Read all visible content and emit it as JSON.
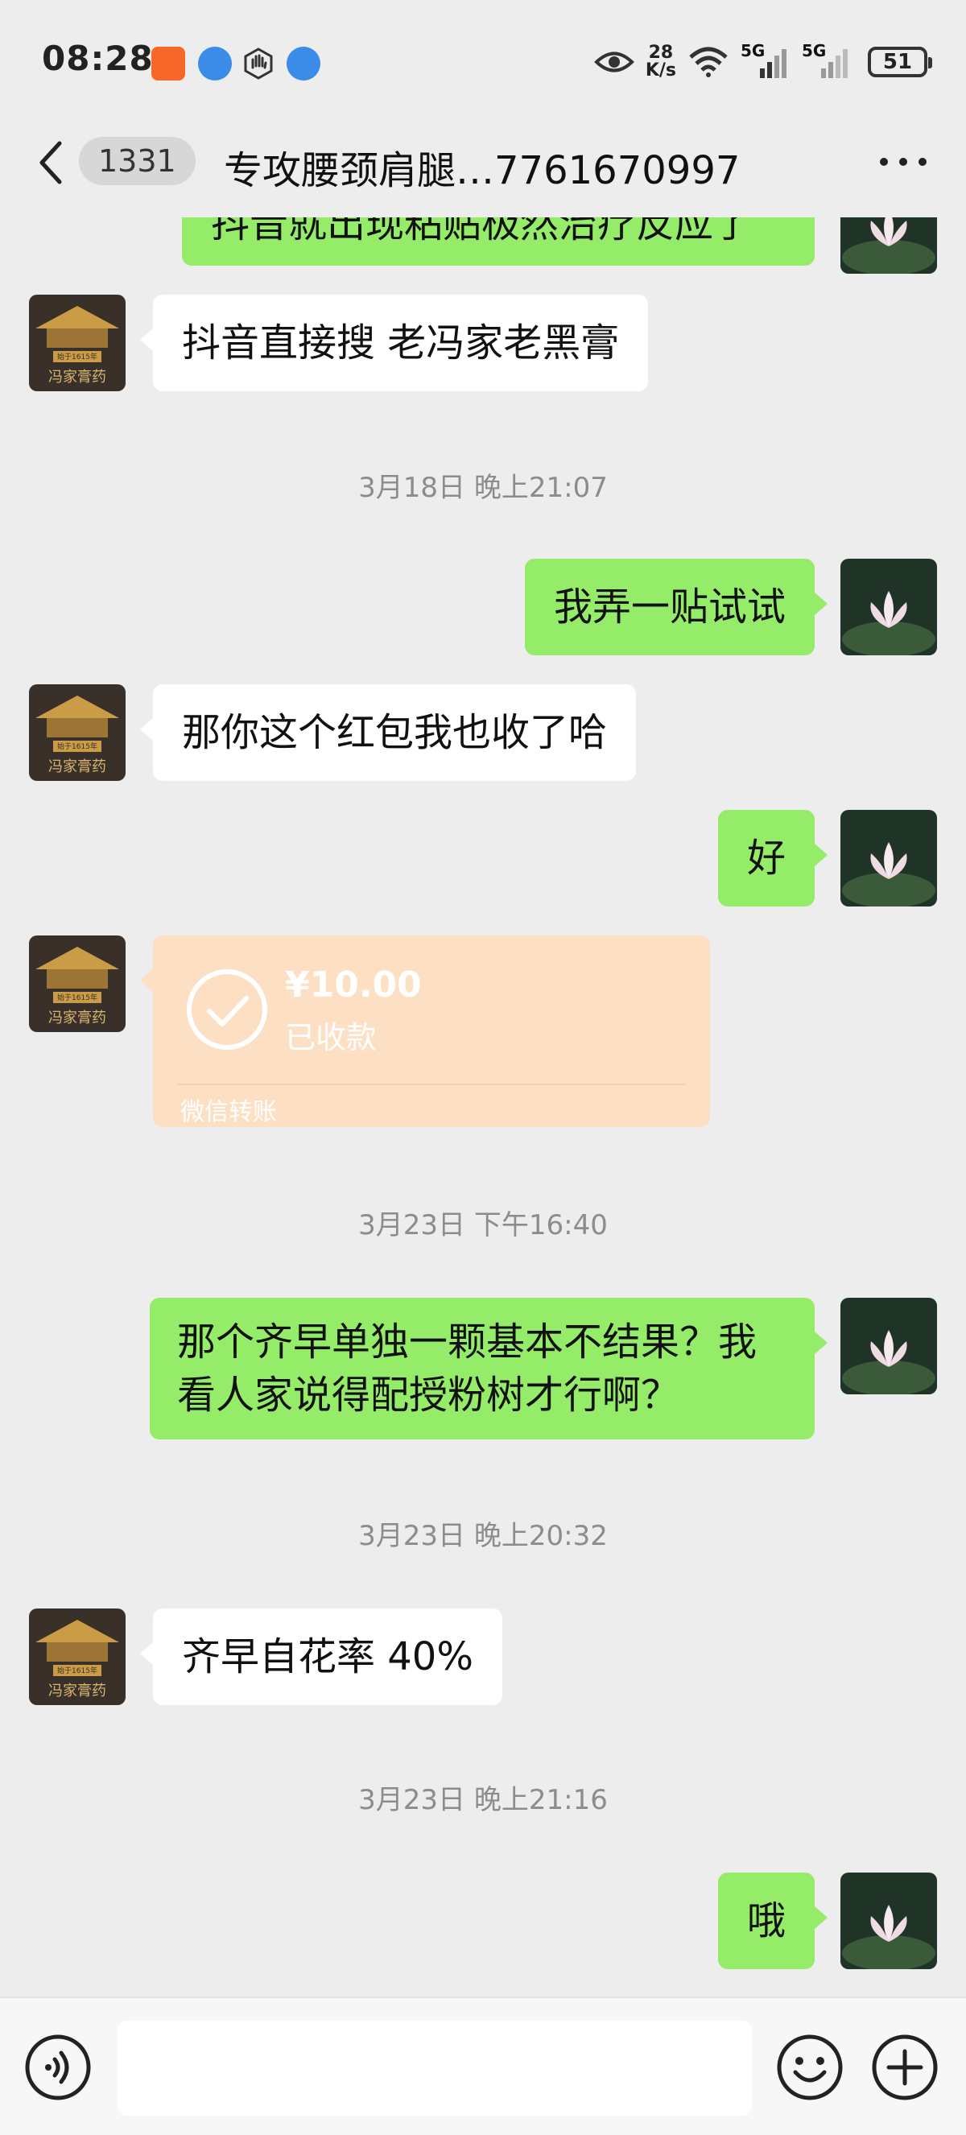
{
  "status_bar": {
    "time": "08:28",
    "net_speed_value": "28",
    "net_speed_unit": "K/s",
    "signal_label_1": "5G",
    "signal_label_2": "5G",
    "battery": "51"
  },
  "header": {
    "unread_count": "1331",
    "title": "专攻腰颈肩腿…7761670997"
  },
  "messages": {
    "m0_partial": "抖音就出现粘贴极然治疗反应了",
    "m1": "抖音直接搜  老冯家老黑膏",
    "ts1": "3月18日 晚上21:07",
    "m2": "我弄一贴试试",
    "m3": "那你这个红包我也收了哈",
    "m4": "好",
    "transfer_amount": "¥10.00",
    "transfer_status": "已收款",
    "transfer_label": "微信转账",
    "ts2": "3月23日 下午16:40",
    "m5": "那个齐早单独一颗基本不结果？我看人家说得配授粉树才行啊？",
    "ts3": "3月23日 晚上20:32",
    "m6": "齐早自花率 40%",
    "ts4": "3月23日 晚上21:16",
    "m7": "哦"
  },
  "contact_avatar_text": {
    "year_badge": "始于1615年",
    "brand": "冯家膏药"
  },
  "input": {
    "value": ""
  },
  "colors": {
    "bubble_mine": "#95ec69",
    "bubble_theirs": "#ffffff",
    "transfer_bg": "#fde0c3",
    "background": "#ededed"
  },
  "icons": [
    "back-arrow-icon",
    "more-icon",
    "voice-icon",
    "emoji-icon",
    "plus-icon",
    "check-icon",
    "eye-icon",
    "wifi-icon",
    "signal-icon",
    "battery-icon"
  ]
}
